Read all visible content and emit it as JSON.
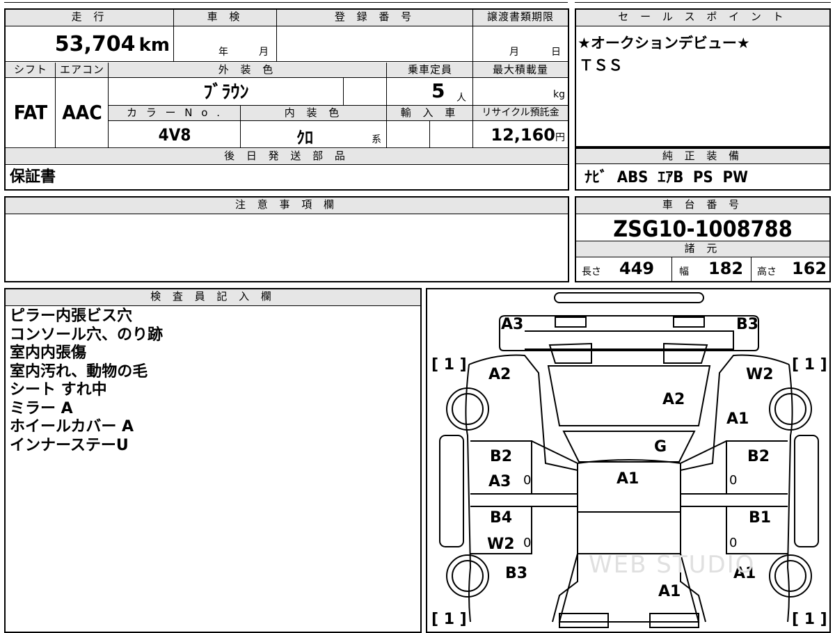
{
  "top_table": {
    "headers": {
      "mileage": "走 行",
      "inspection": "車 検",
      "registration": "登 録 番 号",
      "transfer_deadline": "譲渡書類期限",
      "shift": "シフト",
      "aircon": "エアコン",
      "exterior_color": "外 装 色",
      "capacity": "乗車定員",
      "max_load": "最大積載量",
      "color_no": "カ ラ ー N o .",
      "interior_color": "内 装 色",
      "import": "輸 入 車",
      "recycle": "リサイクル預託金",
      "later_parts": "後 日 発 送 部 品"
    },
    "values": {
      "mileage": "53,704",
      "mileage_unit": "km",
      "year_label": "年",
      "month_label": "月",
      "deadline_month": "月",
      "deadline_day": "日",
      "shift": "FAT",
      "aircon": "AAC",
      "exterior_color": "ﾌﾞﾗｳﾝ",
      "capacity": "5",
      "capacity_unit": "人",
      "max_load_unit": "kg",
      "color_no": "4V8",
      "interior_color": "ｸﾛ",
      "interior_suffix": "系",
      "recycle": "12,160",
      "recycle_unit": "円",
      "later_parts": "保証書"
    }
  },
  "sales_point": {
    "header": "セ ー ル ス ポ イ ン ト",
    "lines": [
      "★オークションデビュー★",
      "ＴＳＳ"
    ]
  },
  "genuine_equipment": {
    "header": "純 正 装 備",
    "value": "ﾅﾋﾞ  ABS  ｴｱB  PS  PW"
  },
  "caution": {
    "header": "注 意 事 項 欄"
  },
  "chassis": {
    "header": "車 台 番 号",
    "value": "ZSG10-1008788"
  },
  "specs": {
    "header": "諸 元",
    "length_label": "長さ",
    "length": "449",
    "width_label": "幅",
    "width": "182",
    "height_label": "高さ",
    "height": "162"
  },
  "inspector": {
    "header": "検 査 員 記 入 欄",
    "lines": [
      "ピラー内張ビス穴",
      "コンソール穴、のり跡",
      "室内内張傷",
      "室内汚れ、動物の毛",
      "シート すれ中",
      "ミラー A",
      "ホイールカバー A",
      "インナーステーU"
    ]
  },
  "diagram": {
    "marks": {
      "a3_rear_left": "A3",
      "b3_rear_right": "B3",
      "a2_left": "A2",
      "w2_right": "W2",
      "a2_roof": "A2",
      "a1_right_upper": "A1",
      "g_glass": "G",
      "b2_left_door": "B2",
      "a3_left_door": "A3",
      "b2_right_door": "B2",
      "a1_roof": "A1",
      "b4_left_door": "B4",
      "w2_left_door": "W2",
      "b1_right_door": "B1",
      "b3_left_front": "B3",
      "a1_right_front": "A1",
      "a1_hood": "A1"
    },
    "brackets": {
      "tl": "[ 1 ]",
      "tr": "[ 1 ]",
      "bl": "[ 1 ]",
      "br": "[ 1 ]"
    },
    "zero": "0",
    "watermark": "WEB STUDIO"
  }
}
